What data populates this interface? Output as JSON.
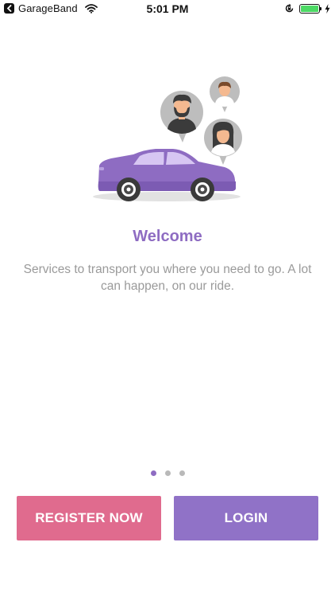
{
  "status_bar": {
    "back_app": "GarageBand",
    "time": "5:01 PM"
  },
  "welcome": {
    "title": "Welcome",
    "text": "Services to transport you where you need to go. A lot can happen, on our ride."
  },
  "pager": {
    "count": 3,
    "active_index": 0
  },
  "buttons": {
    "register": "REGISTER NOW",
    "login": "LOGIN"
  },
  "colors": {
    "accent": "#8e6cc2",
    "register_button": "#e06b8e",
    "login_button": "#9072c7",
    "battery": "#4cd964"
  },
  "icons": [
    "back-icon",
    "wifi-icon",
    "orientation-lock-icon",
    "battery-icon",
    "charging-bolt-icon"
  ]
}
